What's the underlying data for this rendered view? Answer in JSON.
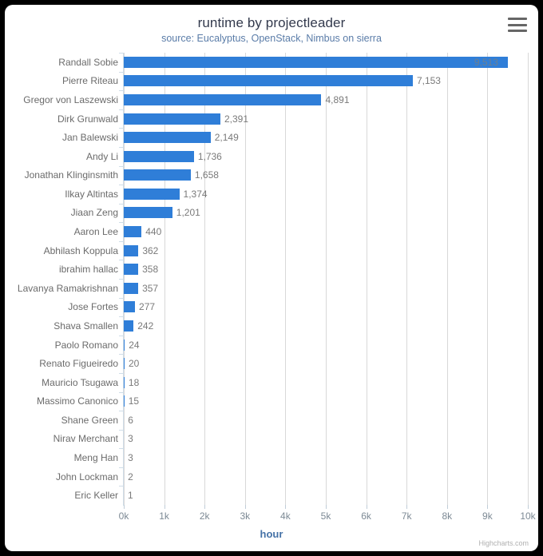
{
  "chart": {
    "title": "runtime by projectleader",
    "subtitle": "source: Eucalyptus, OpenStack, Nimbus on sierra",
    "xaxis_title": "hour",
    "credits": "Highcharts.com",
    "menu_icon": "hamburger-menu-icon",
    "bar_color": "#2f7ed8",
    "title_color": "#333a4d",
    "subtitle_color": "#5a7ca8",
    "axis_title_color": "#4572a7"
  },
  "chart_data": {
    "type": "bar",
    "title": "runtime by projectleader",
    "subtitle": "source: Eucalyptus, OpenStack, Nimbus on sierra",
    "xlabel": "hour",
    "ylabel": "",
    "orientation": "horizontal",
    "xlim": [
      0,
      10000
    ],
    "grid": true,
    "legend": false,
    "tick_labels": [
      "0k",
      "1k",
      "2k",
      "3k",
      "4k",
      "5k",
      "6k",
      "7k",
      "8k",
      "9k",
      "10k"
    ],
    "tick_values": [
      0,
      1000,
      2000,
      3000,
      4000,
      5000,
      6000,
      7000,
      8000,
      9000,
      10000
    ],
    "categories": [
      "Randall Sobie",
      "Pierre Riteau",
      "Gregor von Laszewski",
      "Dirk Grunwald",
      "Jan Balewski",
      "Andy Li",
      "Jonathan Klinginsmith",
      "Ilkay Altintas",
      "Jiaan Zeng",
      "Aaron Lee",
      "Abhilash Koppula",
      "ibrahim hallac",
      "Lavanya Ramakrishnan",
      "Jose Fortes",
      "Shava Smallen",
      "Paolo Romano",
      "Renato Figueiredo",
      "Mauricio Tsugawa",
      "Massimo Canonico",
      "Shane Green",
      "Nirav Merchant",
      "Meng Han",
      "John Lockman",
      "Eric Keller"
    ],
    "values": [
      9513,
      7153,
      4891,
      2391,
      2149,
      1736,
      1658,
      1374,
      1201,
      440,
      362,
      358,
      357,
      277,
      242,
      24,
      20,
      18,
      15,
      6,
      3,
      3,
      2,
      1
    ],
    "data_labels": [
      "9,513",
      "7,153",
      "4,891",
      "2,391",
      "2,149",
      "1,736",
      "1,658",
      "1,374",
      "1,201",
      "440",
      "362",
      "358",
      "357",
      "277",
      "242",
      "24",
      "20",
      "18",
      "15",
      "6",
      "3",
      "3",
      "2",
      "1"
    ]
  }
}
